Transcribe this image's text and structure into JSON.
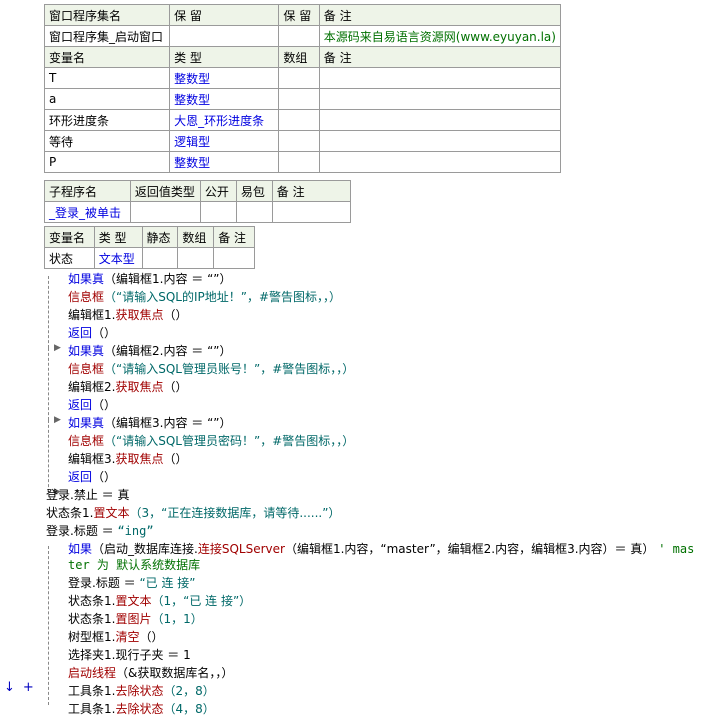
{
  "program_set_table": {
    "header": [
      "窗口程序集名",
      "保 留",
      "保 留",
      "备 注"
    ],
    "row": [
      "窗口程序集_启动窗口",
      "",
      "",
      "本源码来自易语言资源网(www.eyuyan.la)"
    ],
    "var_header": [
      "变量名",
      "类 型",
      "数组",
      "备 注"
    ],
    "vars": [
      {
        "name": "T",
        "type": "整数型"
      },
      {
        "name": "a",
        "type": "整数型"
      },
      {
        "name": "环形进度条",
        "type": "大恩_环形进度条"
      },
      {
        "name": "等待",
        "type": "逻辑型"
      },
      {
        "name": "P",
        "type": "整数型"
      }
    ]
  },
  "sub_table": {
    "header": [
      "子程序名",
      "返回值类型",
      "公开",
      "易包",
      "备 注"
    ],
    "row": [
      "_登录_被单击",
      "",
      "",
      "",
      ""
    ]
  },
  "local_table": {
    "header": [
      "变量名",
      "类 型",
      "静态",
      "数组",
      "备 注"
    ],
    "row": [
      "状态",
      "文本型",
      "",
      "",
      ""
    ]
  },
  "code_lines": {
    "l1a": "如果真",
    "l1b": "（编辑框1.内容 ＝ “”）",
    "l2a": "信息框",
    "l2b": "（“请输入SQL的IP地址！”，#警告图标，，）",
    "l3a": "编辑框1.",
    "l3b": "获取焦点",
    "l3c": "（）",
    "l4a": "返回",
    "l4b": "（）",
    "l5a": "如果真",
    "l5b": "（编辑框2.内容 ＝ “”）",
    "l6a": "信息框",
    "l6b": "（“请输入SQL管理员账号！”，#警告图标，，）",
    "l7a": "编辑框2.",
    "l7b": "获取焦点",
    "l7c": "（）",
    "l8a": "返回",
    "l8b": "（）",
    "l9a": "如果真",
    "l9b": "（编辑框3.内容 ＝ “”）",
    "l10a": "信息框",
    "l10b": "（“请输入SQL管理员密码！”，#警告图标，，）",
    "l11a": "编辑框3.",
    "l11b": "获取焦点",
    "l11c": "（）",
    "l12a": "返回",
    "l12b": "（）",
    "l13a": "登录.禁止 ＝ ",
    "l13b": "真",
    "l14a": "状态条1.",
    "l14b": "置文本",
    "l14c": "（3，“正在连接数据库，请等待......”）",
    "l15a": "登录.标题 ＝ ",
    "l15b": "“ing”",
    "l16a": "如果",
    "l16b": "（启动_数据库连接.",
    "l16c": "连接SQLServer",
    "l16d": "（编辑框1.内容，“master”，编辑框2.内容，编辑框3.内容）＝ 真）",
    "l16e": "' mas",
    "l16f": "ter 为 默认系统数据库",
    "l17a": "登录.标题 ＝ ",
    "l17b": "“已 连 接”",
    "l18a": "状态条1.",
    "l18b": "置文本",
    "l18c": "（1，“已 连 接”）",
    "l19a": "状态条1.",
    "l19b": "置图片",
    "l19c": "（1，1）",
    "l20a": "树型框1.",
    "l20b": "清空",
    "l20c": "（）",
    "l21a": "选择夹1.现行子夹 ＝ 1",
    "l22a": "启动线程",
    "l22b": "（&获取数据库名，，）",
    "l23a": "工具条1.",
    "l23b": "去除状态",
    "l23c": "（2，8）",
    "l24a": "工具条1.",
    "l24b": "去除状态",
    "l24c": "（4，8）"
  },
  "gutter": {
    "down_arrow": "↓",
    "plus": "+"
  },
  "colors": {
    "header_bg": "#eef4e8",
    "keyword": "#0000e0",
    "call": "#a00000",
    "string": "#006868",
    "comment": "#007000"
  }
}
